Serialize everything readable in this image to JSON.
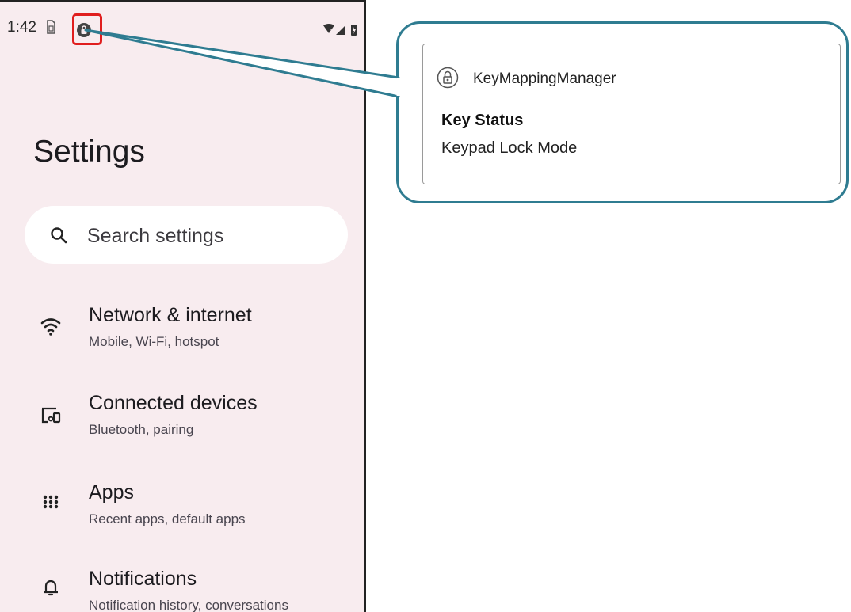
{
  "status_bar": {
    "time": "1:42"
  },
  "settings": {
    "title": "Settings",
    "search_placeholder": "Search settings",
    "items": [
      {
        "icon": "wifi-icon",
        "title": "Network & internet",
        "subtitle": "Mobile, Wi-Fi, hotspot"
      },
      {
        "icon": "devices-icon",
        "title": "Connected devices",
        "subtitle": "Bluetooth, pairing"
      },
      {
        "icon": "apps-grid-icon",
        "title": "Apps",
        "subtitle": "Recent apps, default apps"
      },
      {
        "icon": "bell-icon",
        "title": "Notifications",
        "subtitle": "Notification history, conversations"
      }
    ]
  },
  "notification": {
    "app_name": "KeyMappingManager",
    "title": "Key Status",
    "text": "Keypad Lock Mode"
  },
  "colors": {
    "callout_border": "#2f7c91",
    "highlight": "#e01e1e",
    "phone_bg": "#f8ecef"
  }
}
